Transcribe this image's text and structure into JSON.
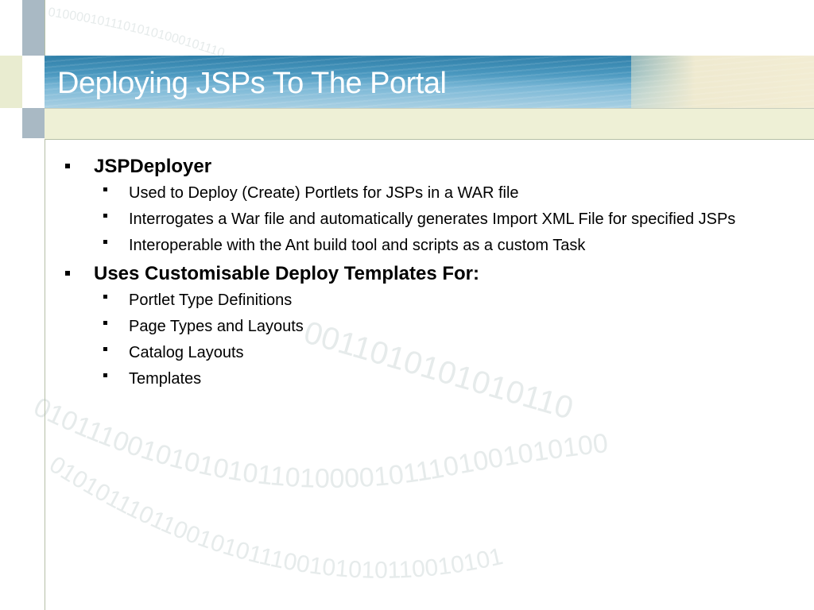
{
  "slide": {
    "title": "Deploying JSPs To The Portal",
    "sections": [
      {
        "heading": "JSPDeployer",
        "items": [
          "Used to Deploy (Create) Portlets for JSPs in a WAR file",
          "Interrogates a War file and automatically generates Import XML File for specified JSPs",
          "Interoperable with the Ant build tool and scripts as a custom Task"
        ]
      },
      {
        "heading": "Uses Customisable Deploy Templates For:",
        "items": [
          "Portlet Type Definitions",
          "Page Types and Layouts",
          "Catalog Layouts",
          "Templates"
        ]
      }
    ]
  },
  "colors": {
    "title_text": "#ffffff",
    "banner_blue": "#4a98bf",
    "accent_tan": "#eef0d6",
    "body_text": "#000000"
  }
}
